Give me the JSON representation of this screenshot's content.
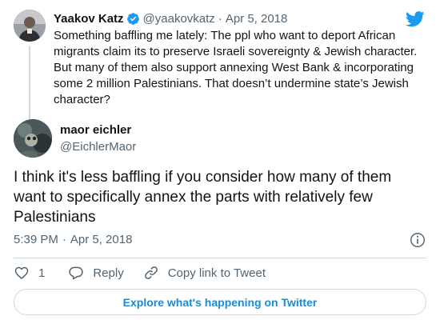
{
  "parent_tweet": {
    "name": "Yaakov Katz",
    "handle": "@yaakovkatz",
    "separator": "·",
    "date": "Apr 5, 2018",
    "text": "Something baffling me lately: The ppl who want to deport African migrants claim its to preserve Israeli sovereignty & Jewish character. But many of them also support annexing West Bank & incorporating some 2 million Palestinians. That doesn’t undermine state’s Jewish character?"
  },
  "tweet": {
    "name": "maor eichler",
    "handle": "@EichlerMaor",
    "text": "I think it's less baffling if you consider how many of them want to specifically annex the parts with relatively few Palestinians",
    "time": "5:39 PM",
    "separator": "·",
    "date": "Apr 5, 2018"
  },
  "actions": {
    "like_count": "1",
    "reply_label": "Reply",
    "copy_link_label": "Copy link to Tweet"
  },
  "explore_label": "Explore what's happening on Twitter",
  "icons": {
    "brand": "twitter-bird-icon",
    "verified": "verified-badge-icon",
    "info": "info-icon",
    "like": "heart-icon",
    "reply": "reply-bubble-icon",
    "link": "link-icon"
  },
  "colors": {
    "brand": "#1d9bf0",
    "text": "#0f1419",
    "secondary": "#536471",
    "border": "#cfd9de"
  }
}
